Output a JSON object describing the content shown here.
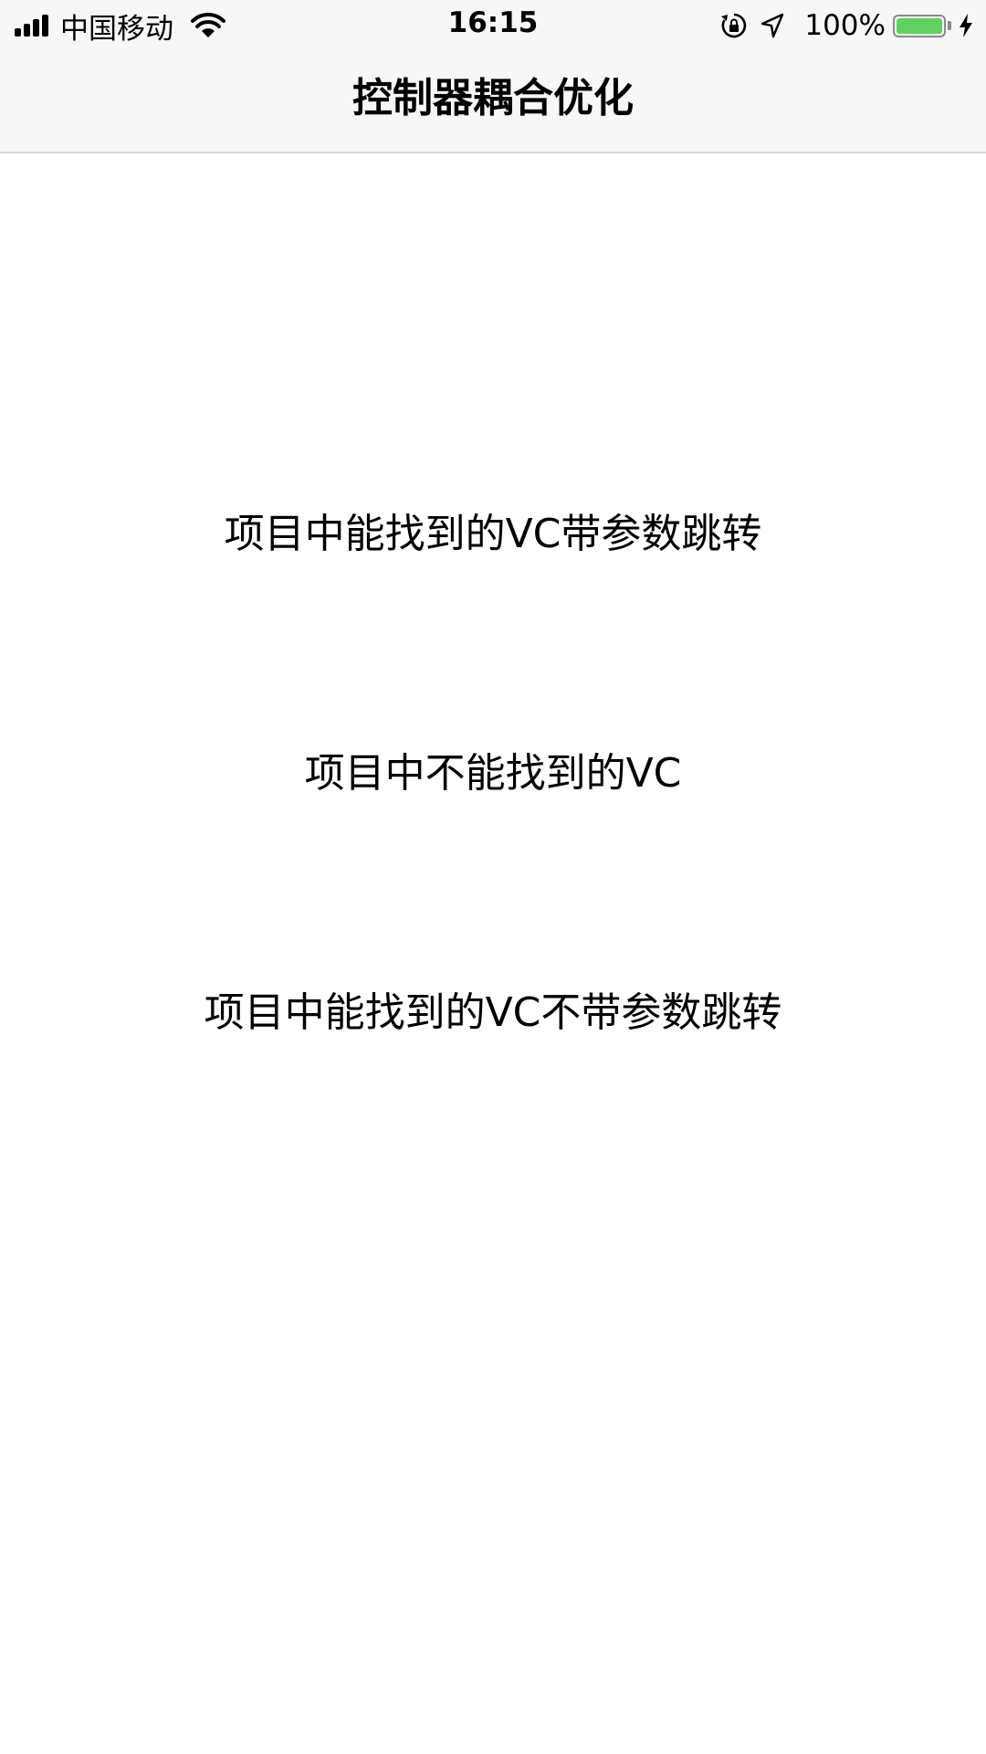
{
  "status_bar": {
    "carrier": "中国移动",
    "time": "16:15",
    "battery_percent": "100%",
    "battery_level": 1.0,
    "battery_color": "#5fd35f",
    "icons": [
      "signal-icon",
      "wifi-icon",
      "orientation-lock-icon",
      "location-arrow-icon",
      "battery-icon",
      "charging-bolt-icon"
    ]
  },
  "nav": {
    "title": "控制器耦合优化"
  },
  "actions": [
    {
      "label": "项目中能找到的VC带参数跳转"
    },
    {
      "label": "项目中不能找到的VC"
    },
    {
      "label": "项目中能找到的VC不带参数跳转"
    }
  ]
}
